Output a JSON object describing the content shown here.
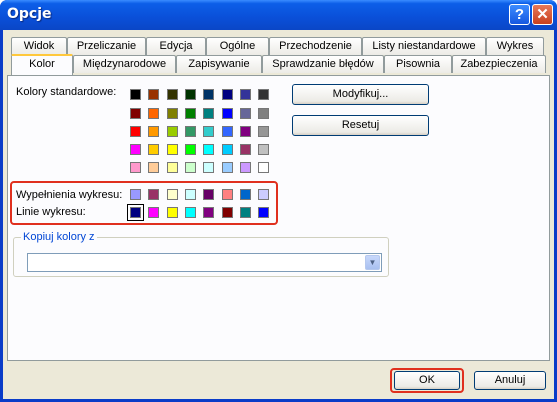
{
  "window": {
    "title": "Opcje",
    "help_glyph": "?",
    "close_glyph": "✕"
  },
  "tabs_row1": [
    "Widok",
    "Przeliczanie",
    "Edycja",
    "Ogólne",
    "Przechodzenie",
    "Listy niestandardowe",
    "Wykres"
  ],
  "tabs_row2": [
    "Kolor",
    "Międzynarodowe",
    "Zapisywanie",
    "Sprawdzanie błędów",
    "Pisownia",
    "Zabezpieczenia"
  ],
  "active_tab": "Kolor",
  "standard": {
    "label": "Kolory standardowe:",
    "rows": [
      [
        "#000000",
        "#993300",
        "#333300",
        "#003300",
        "#003366",
        "#000080",
        "#333399",
        "#333333"
      ],
      [
        "#800000",
        "#FF6600",
        "#808000",
        "#008000",
        "#008080",
        "#0000FF",
        "#666699",
        "#808080"
      ],
      [
        "#FF0000",
        "#FF9900",
        "#99CC00",
        "#339966",
        "#33CCCC",
        "#3366FF",
        "#800080",
        "#969696"
      ],
      [
        "#FF00FF",
        "#FFCC00",
        "#FFFF00",
        "#00FF00",
        "#00FFFF",
        "#00CCFF",
        "#993366",
        "#C0C0C0"
      ],
      [
        "#FF99CC",
        "#FFCC99",
        "#FFFF99",
        "#CCFFCC",
        "#CCFFFF",
        "#99CCFF",
        "#CC99FF",
        "#FFFFFF"
      ]
    ]
  },
  "chart_fills": {
    "label": "Wypełnienia wykresu:",
    "colors": [
      "#9999FF",
      "#993366",
      "#FFFFCC",
      "#CCFFFF",
      "#660066",
      "#FF8080",
      "#0066CC",
      "#CCCCFF"
    ]
  },
  "chart_lines": {
    "label": "Linie wykresu:",
    "colors": [
      "#000080",
      "#FF00FF",
      "#FFFF00",
      "#00FFFF",
      "#800080",
      "#800000",
      "#008080",
      "#0000FF"
    ]
  },
  "buttons": {
    "modify": "Modyfikuj...",
    "reset": "Resetuj",
    "ok": "OK",
    "cancel": "Anuluj"
  },
  "copy_colors": {
    "label": "Kopiuj kolory z",
    "value": ""
  }
}
